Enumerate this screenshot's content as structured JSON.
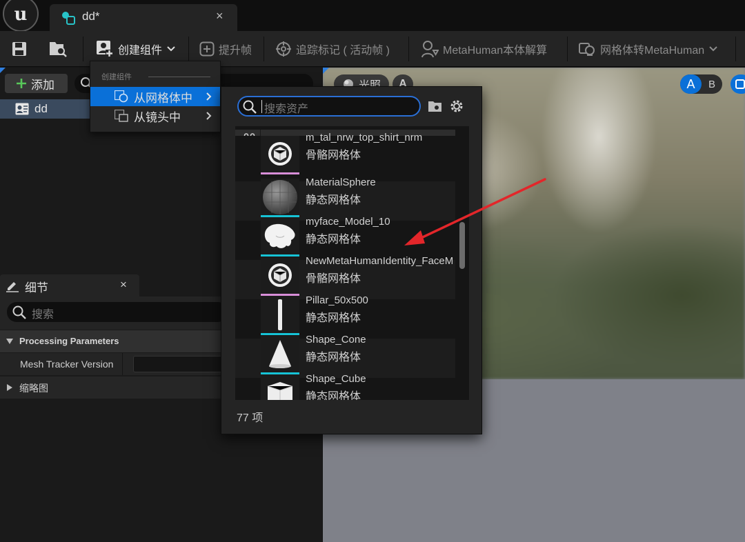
{
  "window": {
    "tab_title": "dd*",
    "close_glyph": "×"
  },
  "toolbar": {
    "save_icon": "save-icon",
    "browse_icon": "browse-asset-icon",
    "create_component": "创建组件",
    "promote_frame": "提升帧",
    "track_markers": "追踪标记 ( 活动帧 )",
    "metahuman_identity_solve": "MetaHuman本体解算",
    "mesh_to_metahuman": "网格体转MetaHuman"
  },
  "components_panel": {
    "add_label": "添加",
    "tree_items": [
      {
        "label": "dd"
      }
    ]
  },
  "details_panel": {
    "title": "细节",
    "search_placeholder": "搜索",
    "section": "Processing Parameters",
    "property_label": "Mesh Tracker Version",
    "collapsed_section": "缩略图"
  },
  "viewport": {
    "lighting_label": "光照",
    "view_a": "A",
    "ab_a": "A",
    "ab_b": "B"
  },
  "create_menu": {
    "header": "创建组件",
    "items": [
      {
        "label": "从网格体中",
        "selected": true
      },
      {
        "label": "从镜头中",
        "selected": false
      }
    ]
  },
  "asset_picker": {
    "search_placeholder": "搜索资产",
    "column_header": "命名",
    "items": [
      {
        "name": "m_tal_nrw_top_shirt_nrm",
        "type": "骨骼网格体",
        "kind": "skeletal"
      },
      {
        "name": "MaterialSphere",
        "type": "静态网格体",
        "kind": "static"
      },
      {
        "name": "myface_Model_10",
        "type": "静态网格体",
        "kind": "static"
      },
      {
        "name": "NewMetaHumanIdentity_FaceM",
        "type": "骨骼网格体",
        "kind": "skeletal"
      },
      {
        "name": "Pillar_50x500",
        "type": "静态网格体",
        "kind": "static"
      },
      {
        "name": "Shape_Cone",
        "type": "静态网格体",
        "kind": "static"
      },
      {
        "name": "Shape_Cube",
        "type": "静态网格体",
        "kind": "static"
      }
    ],
    "item_count": "77 项"
  },
  "colors": {
    "accent_blue": "#0a70d8",
    "static_mesh_bar": "#16c3d6",
    "skeletal_mesh_bar": "#d88ed8",
    "annotation_arrow": "#e3262a"
  }
}
